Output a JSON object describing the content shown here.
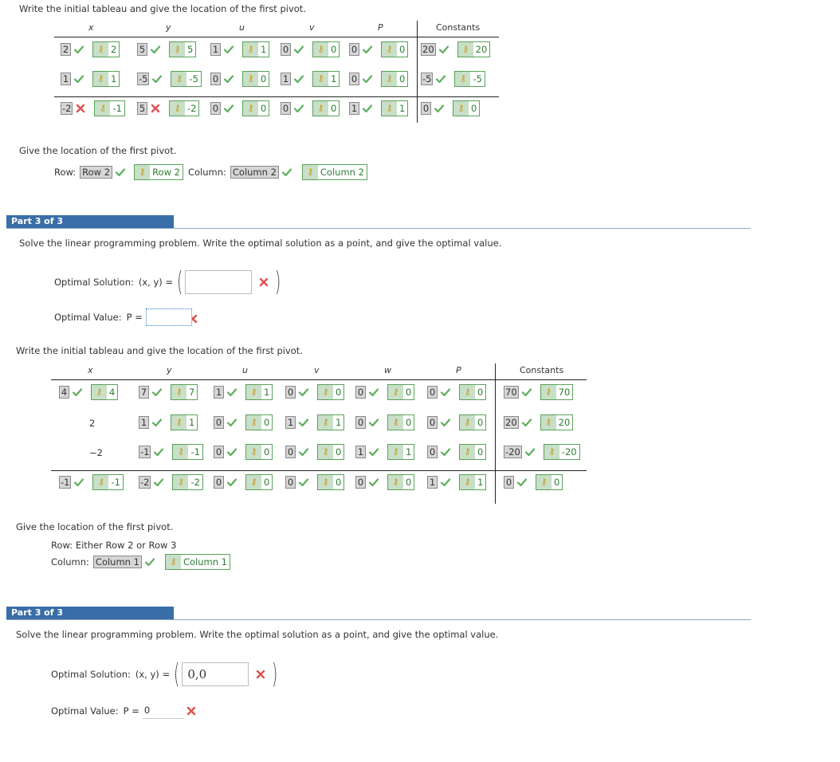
{
  "section1": {
    "instruction": "Write the initial tableau and give the location of the first pivot.",
    "headers": [
      "x",
      "y",
      "u",
      "v",
      "P",
      "Constants"
    ],
    "rows": [
      [
        {
          "ans": "2",
          "status": "correct",
          "key": "2"
        },
        {
          "ans": "5",
          "status": "correct",
          "key": "5"
        },
        {
          "ans": "1",
          "status": "correct",
          "key": "1"
        },
        {
          "ans": "0",
          "status": "correct",
          "key": "0"
        },
        {
          "ans": "0",
          "status": "correct",
          "key": "0"
        },
        {
          "ans": "20",
          "status": "correct",
          "key": "20"
        }
      ],
      [
        {
          "ans": "1",
          "status": "correct",
          "key": "1"
        },
        {
          "ans": "-5",
          "status": "correct",
          "key": "-5"
        },
        {
          "ans": "0",
          "status": "correct",
          "key": "0"
        },
        {
          "ans": "1",
          "status": "correct",
          "key": "1"
        },
        {
          "ans": "0",
          "status": "correct",
          "key": "0"
        },
        {
          "ans": "-5",
          "status": "correct",
          "key": "-5"
        }
      ],
      [
        {
          "ans": "-2",
          "status": "incorrect",
          "key": "-1"
        },
        {
          "ans": "5",
          "status": "incorrect",
          "key": "-2"
        },
        {
          "ans": "0",
          "status": "correct",
          "key": "0"
        },
        {
          "ans": "0",
          "status": "correct",
          "key": "0"
        },
        {
          "ans": "1",
          "status": "correct",
          "key": "1"
        },
        {
          "ans": "0",
          "status": "correct",
          "key": "0"
        }
      ]
    ],
    "pivot_label": "Give the location of the first pivot.",
    "row_label": "Row:",
    "row_answer": "Row 2",
    "row_key": "Row 2",
    "col_label": "Column:",
    "col_answer": "Column 2",
    "col_key": "Column 2"
  },
  "part1": {
    "title": "Part 3 of 3",
    "instruction": "Solve the linear programming problem. Write the optimal solution as a point, and give the optimal value.",
    "solution_label": "Optimal Solution:",
    "solution_vars": "(x, y) =",
    "solution_value": "",
    "value_label": "Optimal Value:",
    "value_var": "P =",
    "value_value": ""
  },
  "section2": {
    "instruction": "Write the initial tableau and give the location of the first pivot.",
    "headers": [
      "x",
      "y",
      "u",
      "v",
      "w",
      "P",
      "Constants"
    ],
    "rows": [
      [
        {
          "ans": "4",
          "status": "correct",
          "key": "4"
        },
        {
          "ans": "7",
          "status": "correct",
          "key": "7"
        },
        {
          "ans": "1",
          "status": "correct",
          "key": "1"
        },
        {
          "ans": "0",
          "status": "correct",
          "key": "0"
        },
        {
          "ans": "0",
          "status": "correct",
          "key": "0"
        },
        {
          "ans": "0",
          "status": "correct",
          "key": "0"
        },
        {
          "ans": "70",
          "status": "correct",
          "key": "70"
        }
      ],
      [
        {
          "plain": "2"
        },
        {
          "ans": "1",
          "status": "correct",
          "key": "1"
        },
        {
          "ans": "0",
          "status": "correct",
          "key": "0"
        },
        {
          "ans": "1",
          "status": "correct",
          "key": "1"
        },
        {
          "ans": "0",
          "status": "correct",
          "key": "0"
        },
        {
          "ans": "0",
          "status": "correct",
          "key": "0"
        },
        {
          "ans": "20",
          "status": "correct",
          "key": "20"
        }
      ],
      [
        {
          "plain": "−2"
        },
        {
          "ans": "-1",
          "status": "correct",
          "key": "-1"
        },
        {
          "ans": "0",
          "status": "correct",
          "key": "0"
        },
        {
          "ans": "0",
          "status": "correct",
          "key": "0"
        },
        {
          "ans": "1",
          "status": "correct",
          "key": "1"
        },
        {
          "ans": "0",
          "status": "correct",
          "key": "0"
        },
        {
          "ans": "-20",
          "status": "correct",
          "key": "-20"
        }
      ],
      [
        {
          "ans": "-1",
          "status": "correct",
          "key": "-1"
        },
        {
          "ans": "-2",
          "status": "correct",
          "key": "-2"
        },
        {
          "ans": "0",
          "status": "correct",
          "key": "0"
        },
        {
          "ans": "0",
          "status": "correct",
          "key": "0"
        },
        {
          "ans": "0",
          "status": "correct",
          "key": "0"
        },
        {
          "ans": "1",
          "status": "correct",
          "key": "1"
        },
        {
          "ans": "0",
          "status": "correct",
          "key": "0"
        }
      ]
    ],
    "pivot_label": "Give the location of the first pivot.",
    "row_text": "Row: Either Row 2 or Row 3",
    "col_label": "Column:",
    "col_answer": "Column 1",
    "col_key": "Column 1"
  },
  "part2": {
    "title": "Part 3 of 3",
    "instruction": "Solve the linear programming problem. Write the optimal solution as a point, and give the optimal value.",
    "solution_label": "Optimal Solution:",
    "solution_vars": "(x, y) =",
    "solution_value": "0,0",
    "value_label": "Optimal Value:",
    "value_var": "P =",
    "value_value": "0"
  },
  "colors": {
    "correct": "#5cae5c",
    "incorrect": "#e05050",
    "part_header": "#3a6ea8",
    "key_text": "#2e7d32"
  }
}
